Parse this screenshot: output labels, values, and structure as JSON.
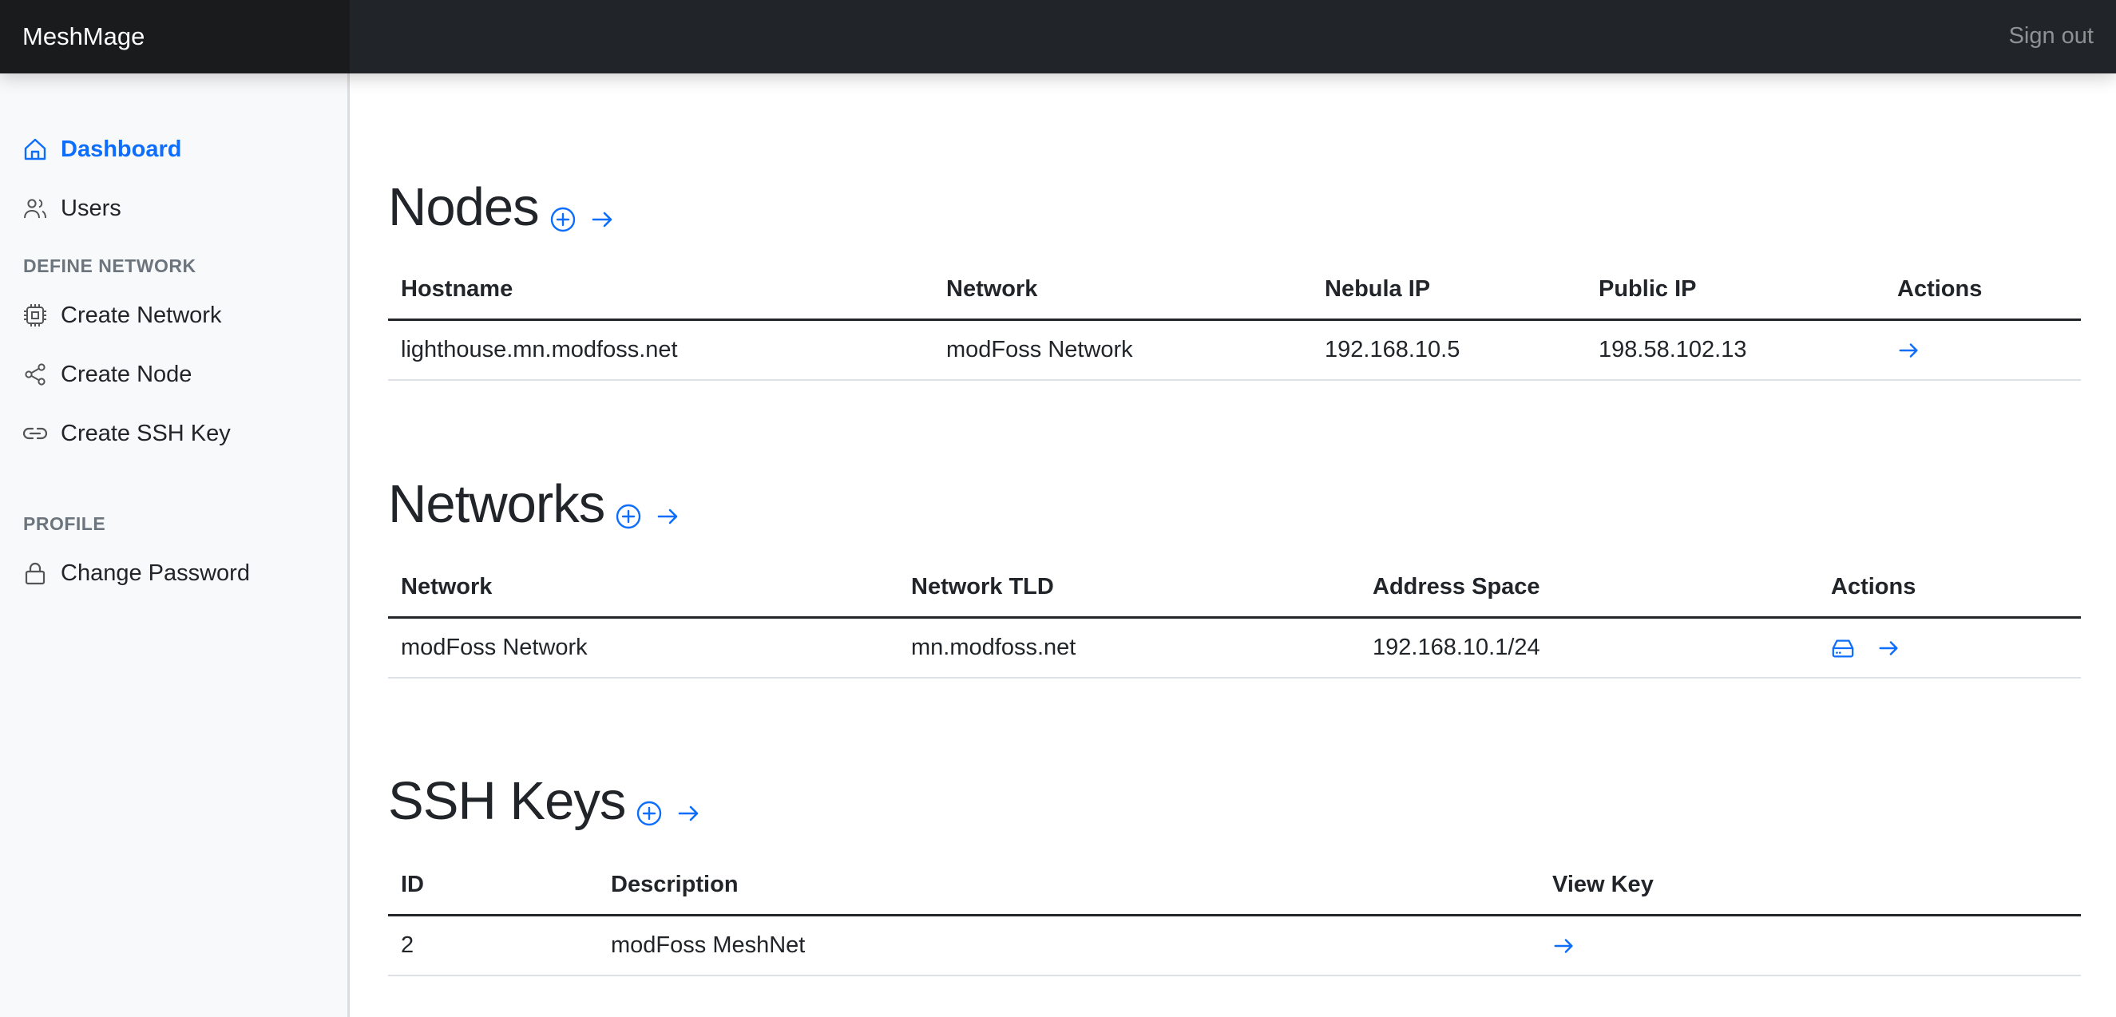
{
  "app": {
    "brand": "MeshMage",
    "sign_out": "Sign out"
  },
  "sidebar": {
    "items": [
      {
        "label": "Dashboard",
        "icon": "house-icon",
        "active": true
      },
      {
        "label": "Users",
        "icon": "people-icon"
      }
    ],
    "sections": [
      {
        "heading": "DEFINE NETWORK",
        "items": [
          {
            "label": "Create Network",
            "icon": "cpu-icon"
          },
          {
            "label": "Create Node",
            "icon": "share-icon"
          },
          {
            "label": "Create SSH Key",
            "icon": "link-icon"
          }
        ]
      },
      {
        "heading": "PROFILE",
        "items": [
          {
            "label": "Change Password",
            "icon": "lock-icon"
          }
        ]
      }
    ]
  },
  "colors": {
    "accent": "#0d6efd",
    "topbar": "#212529",
    "brand_bg": "#1a1b1d",
    "sidebar_bg": "#f8f9fa"
  },
  "nodes": {
    "title": "Nodes",
    "columns": [
      "Hostname",
      "Network",
      "Nebula IP",
      "Public IP",
      "Actions"
    ],
    "rows": [
      {
        "hostname": "lighthouse.mn.modfoss.net",
        "network": "modFoss Network",
        "nebula_ip": "192.168.10.5",
        "public_ip": "198.58.102.13"
      }
    ]
  },
  "networks": {
    "title": "Networks",
    "columns": [
      "Network",
      "Network TLD",
      "Address Space",
      "Actions"
    ],
    "rows": [
      {
        "network": "modFoss Network",
        "tld": "mn.modfoss.net",
        "address_space": "192.168.10.1/24"
      }
    ]
  },
  "ssh_keys": {
    "title": "SSH Keys",
    "columns": [
      "ID",
      "Description",
      "View Key"
    ],
    "rows": [
      {
        "id": "2",
        "description": "modFoss MeshNet"
      }
    ]
  }
}
